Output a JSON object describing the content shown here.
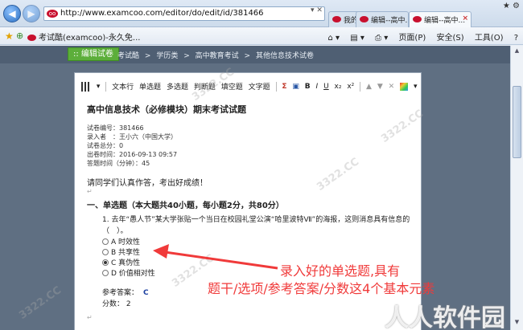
{
  "browser": {
    "url": "http://www.examcoo.com/editor/do/edit/id/381466",
    "tabs": [
      {
        "label": "我的考试酷"
      },
      {
        "label": "编辑--高中..."
      },
      {
        "label": "编辑--高中..."
      }
    ],
    "favorite_tab": "考试酷(examcoo)-永久免...",
    "commands": [
      "页面(P)",
      "安全(S)",
      "工具(O)"
    ]
  },
  "header": {
    "edit_button": "编辑试卷",
    "breadcrumb": [
      "考试酷",
      ">",
      "学历类",
      ">",
      "高中教育考试",
      ">",
      "其他信息技术试卷"
    ]
  },
  "toolbar": {
    "buttons": [
      "文本行",
      "单选题",
      "多选题",
      "判断题",
      "填空题",
      "文字题"
    ]
  },
  "paper": {
    "title": "高中信息技术（必修模块）期末考试试题",
    "meta": [
      "试卷编号：381466",
      "录入者　：王小六（中国大学）",
      "试卷总分：0",
      "出卷时间：2016-09-13 09:57",
      "答题时间（分钟）：45"
    ],
    "prompt": "请同学们认真作答，考出好成绩！",
    "section": "一、单选题（本大题共40小题，每小题2分，共80分）",
    "question": "去年“愚人节”某大学张贴一个当日在校园礼堂公演“哈里波特Ⅶ”的海报，这则消息具有信息的（　）。",
    "question_number": "1.",
    "options": [
      {
        "text": "A 时效性",
        "selected": false
      },
      {
        "text": "B 共享性",
        "selected": false
      },
      {
        "text": "C 真伪性",
        "selected": true
      },
      {
        "text": "D 价值相对性",
        "selected": false
      }
    ],
    "answer_label": "参考答案：",
    "answer_value": "C",
    "score_label": "分数：",
    "score_value": "2"
  },
  "annotation": {
    "line1": "录入好的单选题,具有",
    "line2": "题干/选项/参考答案/分数这4个基本元素"
  },
  "watermark": {
    "site": "3322.CC",
    "brand": "软件园"
  },
  "colors": {
    "annotation": "#f03a3a",
    "edit_button": "#5cae3a",
    "answer": "#1b3fa0"
  }
}
